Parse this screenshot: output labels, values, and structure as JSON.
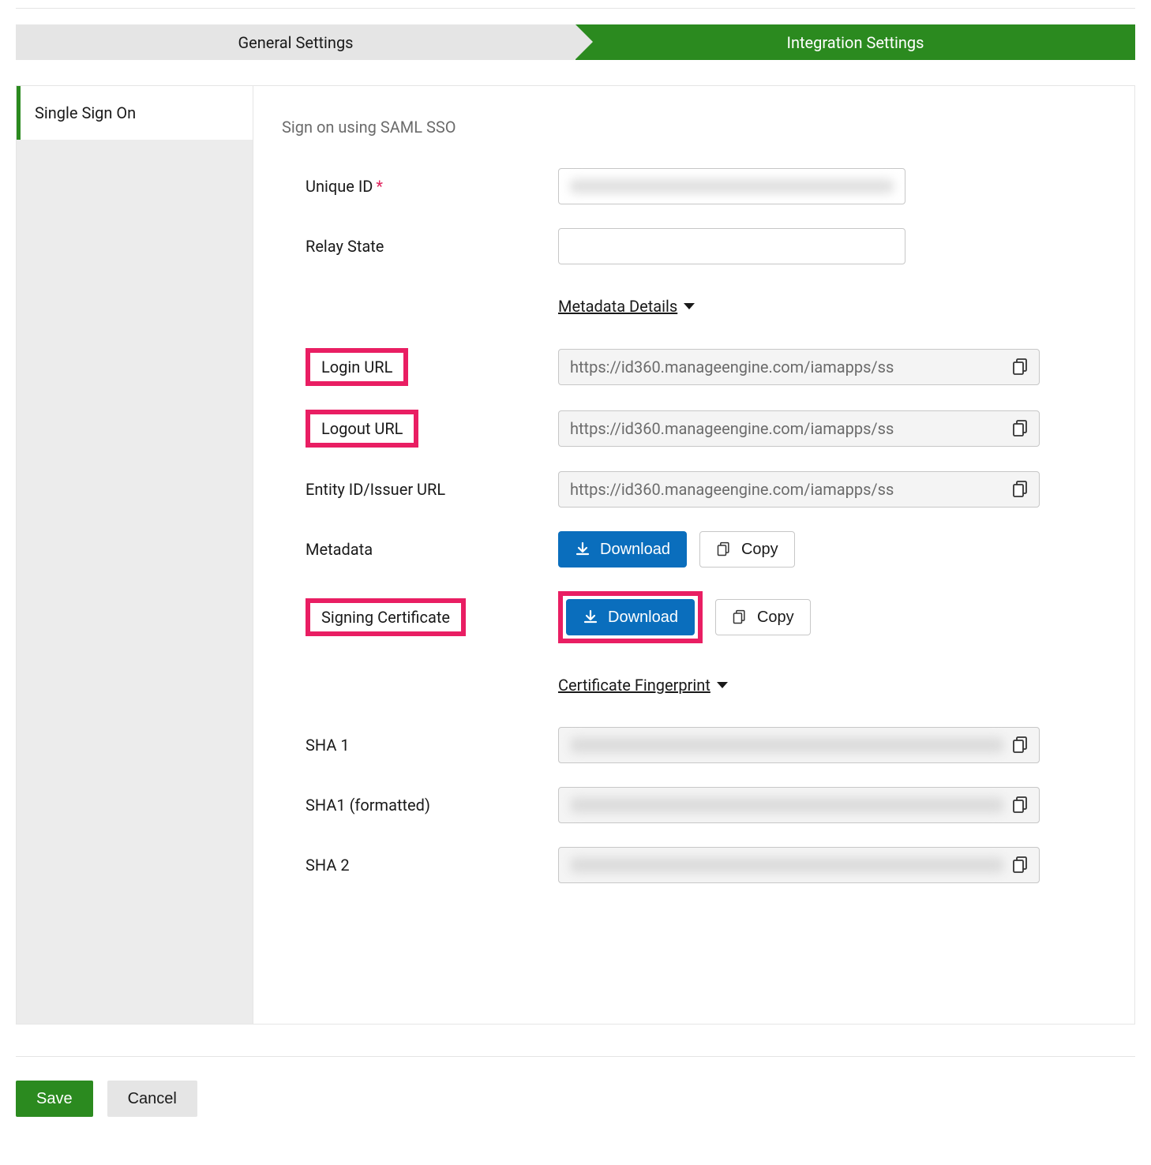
{
  "tabs": {
    "general": "General Settings",
    "integration": "Integration Settings"
  },
  "sidebar": {
    "items": [
      {
        "label": "Single Sign On"
      }
    ]
  },
  "section": {
    "title": "Sign on using SAML SSO",
    "unique_id_label": "Unique ID",
    "relay_state_label": "Relay State",
    "metadata_details_label": "Metadata Details",
    "login_url_label": "Login URL",
    "login_url_value": "https://id360.manageengine.com/iamapps/ss",
    "logout_url_label": "Logout URL",
    "logout_url_value": "https://id360.manageengine.com/iamapps/ss",
    "entity_id_label": "Entity ID/Issuer URL",
    "entity_id_value": "https://id360.manageengine.com/iamapps/ss",
    "metadata_label": "Metadata",
    "signing_cert_label": "Signing Certificate",
    "download_label": "Download",
    "copy_label": "Copy",
    "cert_fingerprint_label": "Certificate Fingerprint",
    "sha1_label": "SHA 1",
    "sha1f_label": "SHA1 (formatted)",
    "sha2_label": "SHA 2"
  },
  "footer": {
    "save": "Save",
    "cancel": "Cancel"
  }
}
